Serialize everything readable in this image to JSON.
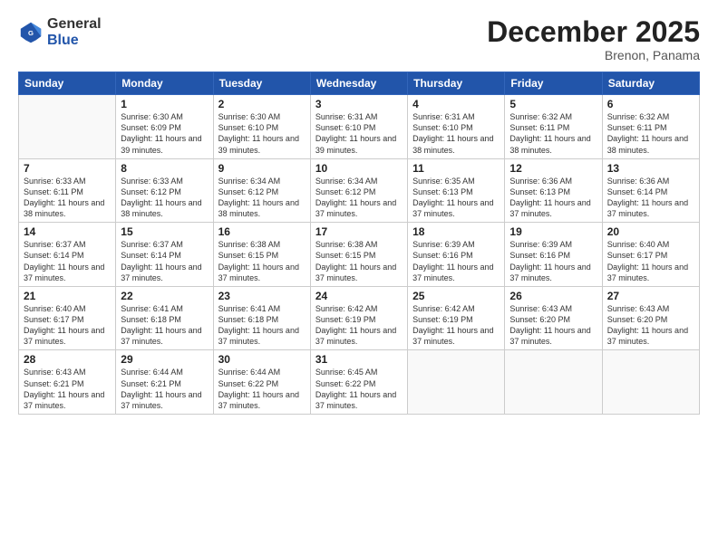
{
  "header": {
    "logo_general": "General",
    "logo_blue": "Blue",
    "month_title": "December 2025",
    "subtitle": "Brenon, Panama"
  },
  "days_of_week": [
    "Sunday",
    "Monday",
    "Tuesday",
    "Wednesday",
    "Thursday",
    "Friday",
    "Saturday"
  ],
  "weeks": [
    [
      {
        "day": "",
        "info": ""
      },
      {
        "day": "1",
        "info": "Sunrise: 6:30 AM\nSunset: 6:09 PM\nDaylight: 11 hours and 39 minutes."
      },
      {
        "day": "2",
        "info": "Sunrise: 6:30 AM\nSunset: 6:10 PM\nDaylight: 11 hours and 39 minutes."
      },
      {
        "day": "3",
        "info": "Sunrise: 6:31 AM\nSunset: 6:10 PM\nDaylight: 11 hours and 39 minutes."
      },
      {
        "day": "4",
        "info": "Sunrise: 6:31 AM\nSunset: 6:10 PM\nDaylight: 11 hours and 38 minutes."
      },
      {
        "day": "5",
        "info": "Sunrise: 6:32 AM\nSunset: 6:11 PM\nDaylight: 11 hours and 38 minutes."
      },
      {
        "day": "6",
        "info": "Sunrise: 6:32 AM\nSunset: 6:11 PM\nDaylight: 11 hours and 38 minutes."
      }
    ],
    [
      {
        "day": "7",
        "info": "Sunrise: 6:33 AM\nSunset: 6:11 PM\nDaylight: 11 hours and 38 minutes."
      },
      {
        "day": "8",
        "info": "Sunrise: 6:33 AM\nSunset: 6:12 PM\nDaylight: 11 hours and 38 minutes."
      },
      {
        "day": "9",
        "info": "Sunrise: 6:34 AM\nSunset: 6:12 PM\nDaylight: 11 hours and 38 minutes."
      },
      {
        "day": "10",
        "info": "Sunrise: 6:34 AM\nSunset: 6:12 PM\nDaylight: 11 hours and 37 minutes."
      },
      {
        "day": "11",
        "info": "Sunrise: 6:35 AM\nSunset: 6:13 PM\nDaylight: 11 hours and 37 minutes."
      },
      {
        "day": "12",
        "info": "Sunrise: 6:36 AM\nSunset: 6:13 PM\nDaylight: 11 hours and 37 minutes."
      },
      {
        "day": "13",
        "info": "Sunrise: 6:36 AM\nSunset: 6:14 PM\nDaylight: 11 hours and 37 minutes."
      }
    ],
    [
      {
        "day": "14",
        "info": "Sunrise: 6:37 AM\nSunset: 6:14 PM\nDaylight: 11 hours and 37 minutes."
      },
      {
        "day": "15",
        "info": "Sunrise: 6:37 AM\nSunset: 6:14 PM\nDaylight: 11 hours and 37 minutes."
      },
      {
        "day": "16",
        "info": "Sunrise: 6:38 AM\nSunset: 6:15 PM\nDaylight: 11 hours and 37 minutes."
      },
      {
        "day": "17",
        "info": "Sunrise: 6:38 AM\nSunset: 6:15 PM\nDaylight: 11 hours and 37 minutes."
      },
      {
        "day": "18",
        "info": "Sunrise: 6:39 AM\nSunset: 6:16 PM\nDaylight: 11 hours and 37 minutes."
      },
      {
        "day": "19",
        "info": "Sunrise: 6:39 AM\nSunset: 6:16 PM\nDaylight: 11 hours and 37 minutes."
      },
      {
        "day": "20",
        "info": "Sunrise: 6:40 AM\nSunset: 6:17 PM\nDaylight: 11 hours and 37 minutes."
      }
    ],
    [
      {
        "day": "21",
        "info": "Sunrise: 6:40 AM\nSunset: 6:17 PM\nDaylight: 11 hours and 37 minutes."
      },
      {
        "day": "22",
        "info": "Sunrise: 6:41 AM\nSunset: 6:18 PM\nDaylight: 11 hours and 37 minutes."
      },
      {
        "day": "23",
        "info": "Sunrise: 6:41 AM\nSunset: 6:18 PM\nDaylight: 11 hours and 37 minutes."
      },
      {
        "day": "24",
        "info": "Sunrise: 6:42 AM\nSunset: 6:19 PM\nDaylight: 11 hours and 37 minutes."
      },
      {
        "day": "25",
        "info": "Sunrise: 6:42 AM\nSunset: 6:19 PM\nDaylight: 11 hours and 37 minutes."
      },
      {
        "day": "26",
        "info": "Sunrise: 6:43 AM\nSunset: 6:20 PM\nDaylight: 11 hours and 37 minutes."
      },
      {
        "day": "27",
        "info": "Sunrise: 6:43 AM\nSunset: 6:20 PM\nDaylight: 11 hours and 37 minutes."
      }
    ],
    [
      {
        "day": "28",
        "info": "Sunrise: 6:43 AM\nSunset: 6:21 PM\nDaylight: 11 hours and 37 minutes."
      },
      {
        "day": "29",
        "info": "Sunrise: 6:44 AM\nSunset: 6:21 PM\nDaylight: 11 hours and 37 minutes."
      },
      {
        "day": "30",
        "info": "Sunrise: 6:44 AM\nSunset: 6:22 PM\nDaylight: 11 hours and 37 minutes."
      },
      {
        "day": "31",
        "info": "Sunrise: 6:45 AM\nSunset: 6:22 PM\nDaylight: 11 hours and 37 minutes."
      },
      {
        "day": "",
        "info": ""
      },
      {
        "day": "",
        "info": ""
      },
      {
        "day": "",
        "info": ""
      }
    ]
  ]
}
